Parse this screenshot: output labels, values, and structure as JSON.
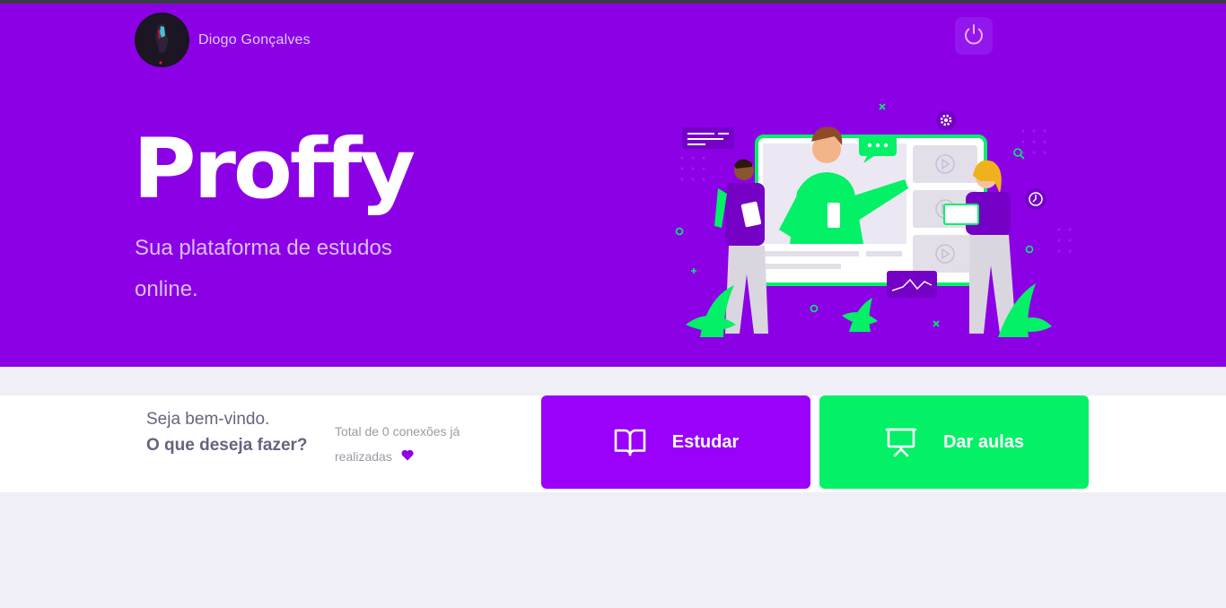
{
  "app": {
    "name": "Proffy"
  },
  "colors": {
    "primary": "#8c00e6",
    "secondary": "#04f067",
    "study_button": "#9a00fa",
    "background": "#f0eef6"
  },
  "header": {
    "user_name": "Diogo Gonçalves",
    "avatar_icon": "user-avatar",
    "logout_icon": "power-icon"
  },
  "hero": {
    "logo_text": "Proffy",
    "tagline": "Sua plataforma de estudos online.",
    "illustration": "landing-illustration"
  },
  "panel": {
    "greeting": "Seja bem-vindo.",
    "question": "O que deseja fazer?",
    "connections_text": "Total de 0 conexões já realizadas",
    "heart_icon": "purple-heart-icon"
  },
  "buttons": {
    "study_label": "Estudar",
    "study_icon": "book-open-icon",
    "give_classes_label": "Dar aulas",
    "give_classes_icon": "presentation-board-icon"
  }
}
